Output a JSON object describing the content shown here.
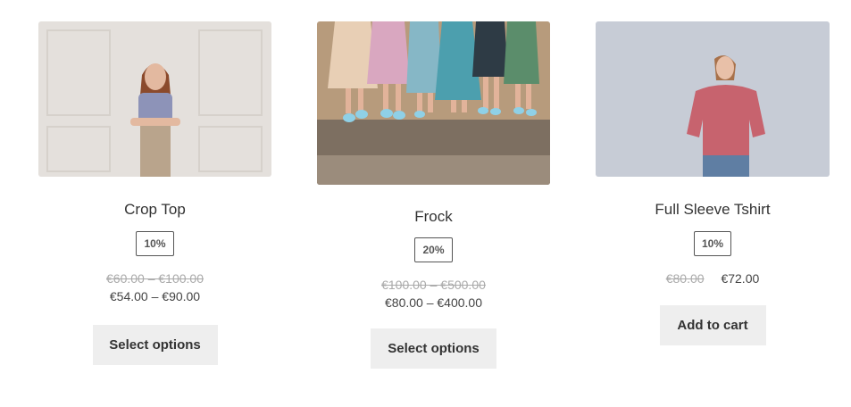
{
  "products": [
    {
      "title": "Crop Top",
      "badge": "10%",
      "old_price": "€60.00 – €100.00",
      "price": "€54.00 – €90.00",
      "button": "Select options",
      "image_icon": "woman-crop-top-photo"
    },
    {
      "title": "Frock",
      "badge": "20%",
      "old_price": "€100.00 – €500.00",
      "price": "€80.00 – €400.00",
      "button": "Select options",
      "image_icon": "group-frocks-photo"
    },
    {
      "title": "Full Sleeve Tshirt",
      "badge": "10%",
      "old_price": "€80.00",
      "price": "€72.00",
      "button": "Add to cart",
      "image_icon": "woman-pink-tshirt-photo"
    }
  ],
  "colors": {
    "button_bg": "#eeeeee",
    "text": "#333333",
    "strike": "#aaaaaa"
  }
}
